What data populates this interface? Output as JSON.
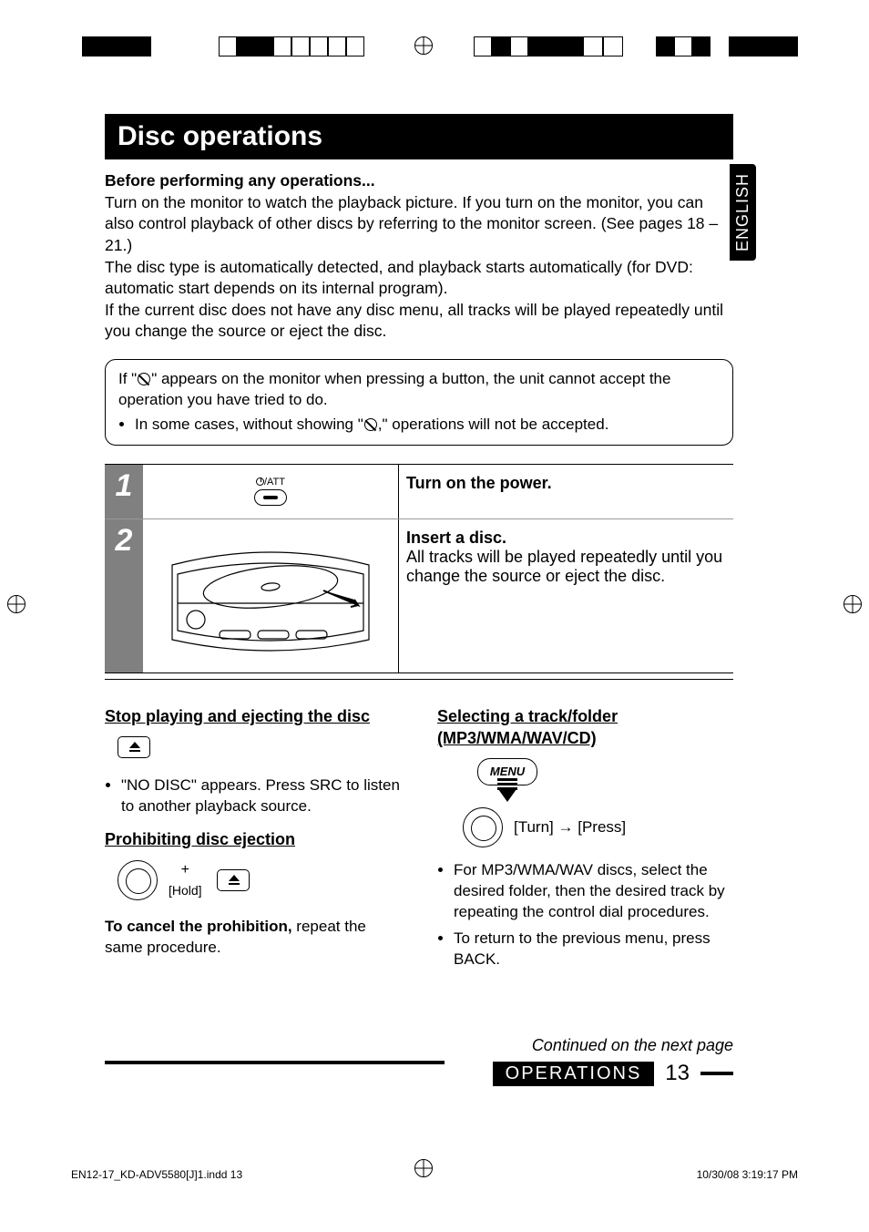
{
  "lang_tab": "ENGLISH",
  "section_title": "Disc operations",
  "intro": {
    "lead": "Before performing any operations...",
    "p1": "Turn on the monitor to watch the playback picture. If you turn on the monitor, you can also control playback of other discs by referring to the monitor screen. (See pages 18 – 21.)",
    "p2": "The disc type is automatically detected, and playback starts automatically (for DVD: automatic start depends on its internal program).",
    "p3": "If the current disc does not have any disc menu, all tracks will be played repeatedly until you change the source or eject the disc."
  },
  "note_box": {
    "line1a": "If \"",
    "line1b": "\" appears on the monitor when pressing a button, the unit cannot accept the operation you have tried to do.",
    "bullet_a": "In some cases, without showing \"",
    "bullet_b": ",\" operations will not be accepted."
  },
  "steps": [
    {
      "num": "1",
      "power_label": "/ATT",
      "title": "Turn on the power.",
      "body": ""
    },
    {
      "num": "2",
      "title": "Insert a disc.",
      "body": "All tracks will be played repeatedly until you change the source or eject the disc."
    }
  ],
  "left_col": {
    "h1": "Stop playing and ejecting the disc",
    "bullet1": "\"NO DISC\" appears. Press SRC to listen to another playback source.",
    "h2": "Prohibiting disc ejection",
    "hold": "[Hold]",
    "cancel_a": "To cancel the prohibition,",
    "cancel_b": " repeat the same procedure."
  },
  "right_col": {
    "h1": "Selecting a track/folder (MP3/WMA/WAV/CD)",
    "menu": "MENU",
    "turn_press": "[Turn] → [Press]",
    "bullet1": "For MP3/WMA/WAV discs, select the desired folder, then the desired track by repeating the control dial procedures.",
    "bullet2": "To return to the previous menu, press BACK."
  },
  "continued": "Continued on the next page",
  "footer": {
    "ops": "OPERATIONS",
    "pagenum": "13"
  },
  "imprint": {
    "file": "EN12-17_KD-ADV5580[J]1.indd   13",
    "date": "10/30/08   3:19:17 PM"
  }
}
